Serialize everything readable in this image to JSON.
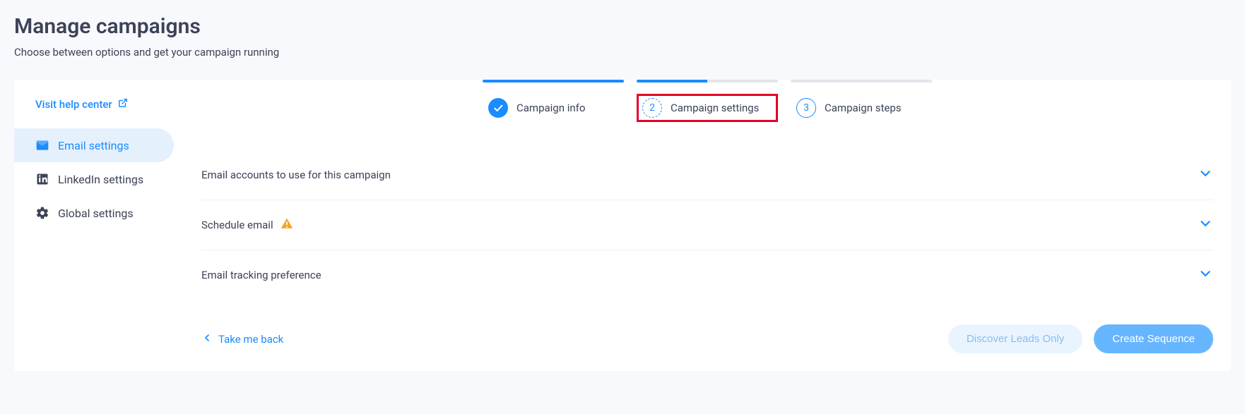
{
  "header": {
    "title": "Manage campaigns",
    "subtitle": "Choose between options and get your campaign running"
  },
  "sidebar": {
    "help_label": "Visit help center",
    "items": [
      {
        "label": "Email settings",
        "icon": "email-envelope-icon",
        "active": true
      },
      {
        "label": "LinkedIn settings",
        "icon": "linkedin-icon",
        "active": false
      },
      {
        "label": "Global settings",
        "icon": "gear-icon",
        "active": false
      }
    ]
  },
  "stepper": [
    {
      "num": "1",
      "label": "Campaign info",
      "state": "done",
      "bar": "complete"
    },
    {
      "num": "2",
      "label": "Campaign settings",
      "state": "current",
      "bar": "partial",
      "highlight": true
    },
    {
      "num": "3",
      "label": "Campaign steps",
      "state": "upcoming",
      "bar": "empty"
    }
  ],
  "accordion": [
    {
      "title": "Email accounts to use for this campaign",
      "warning": false
    },
    {
      "title": "Schedule email",
      "warning": true
    },
    {
      "title": "Email tracking preference",
      "warning": false
    }
  ],
  "footer": {
    "back_label": "Take me back",
    "discover_label": "Discover Leads Only",
    "create_label": "Create Sequence"
  }
}
